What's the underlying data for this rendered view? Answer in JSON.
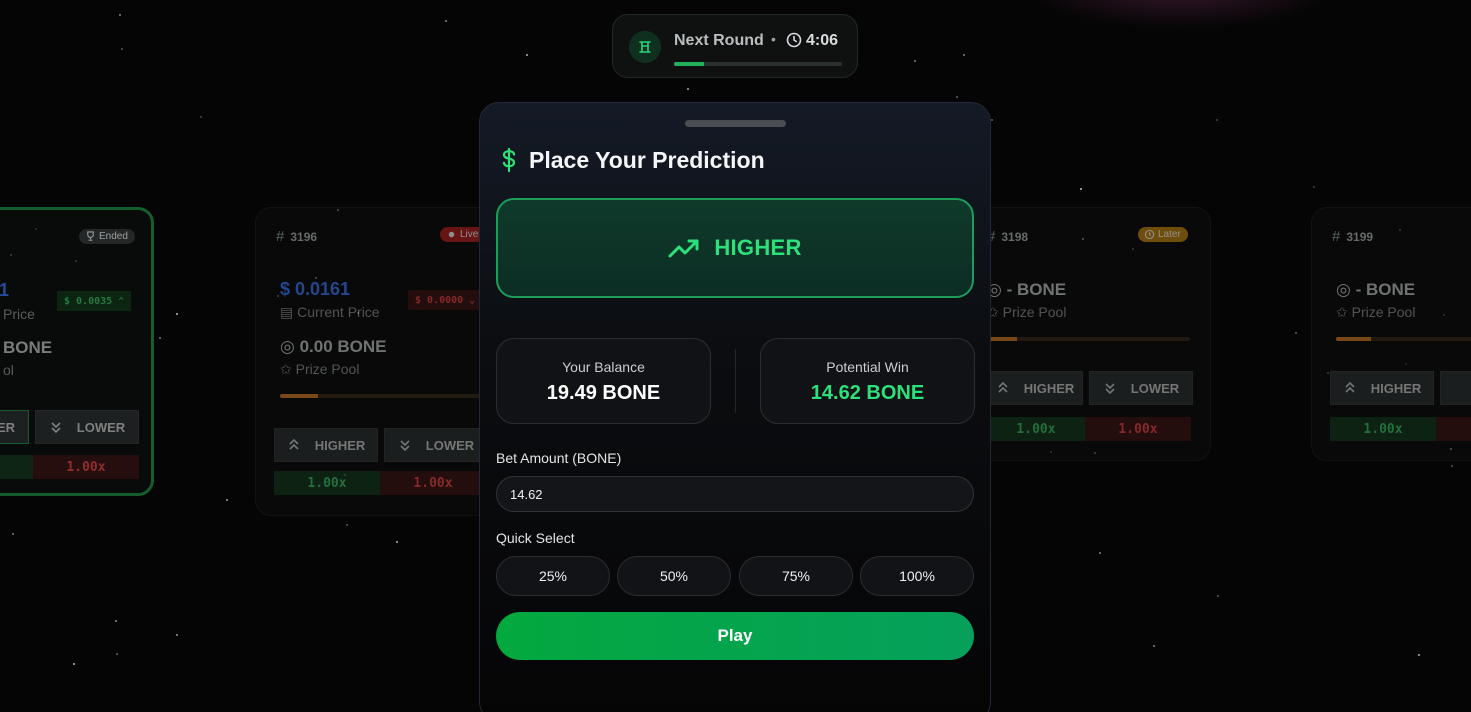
{
  "round": {
    "label": "Next Round",
    "separator": "•",
    "time": "4:06",
    "progress": 0.18
  },
  "cards": [
    {
      "id": "",
      "status": "Ended",
      "price": "",
      "price_label": "Price",
      "delta": "$ 0.0035 ⌃",
      "pool": "BONE",
      "pool_label": "ol",
      "pool_progress": 0,
      "higher_label": "ER",
      "lower_label": "LOWER",
      "higher_mult": "",
      "lower_mult": "1.00x"
    },
    {
      "id": "3196",
      "status": "Live",
      "price": "0.0161",
      "price_label": "Current Price",
      "delta": "$ 0.0000 ⌄",
      "pool": "0.00 BONE",
      "pool_label": "Prize Pool",
      "pool_progress": 0.18,
      "higher_label": "HIGHER",
      "lower_label": "LOWER",
      "higher_mult": "1.00x",
      "lower_mult": "1.00x"
    },
    {
      "id": "3198",
      "status": "Later",
      "pool": "- BONE",
      "pool_label": "Prize Pool",
      "pool_progress": 0.15,
      "higher_label": "HIGHER",
      "lower_label": "LOWER",
      "higher_mult": "1.00x",
      "lower_mult": "1.00x"
    },
    {
      "id": "3199",
      "status": "",
      "pool": "- BONE",
      "pool_label": "Prize Pool",
      "pool_progress": 0.2,
      "higher_label": "HIGHER",
      "lower_label": "",
      "higher_mult": "1.00x",
      "lower_mult": ""
    }
  ],
  "modal": {
    "title": "Place Your Prediction",
    "direction": "HIGHER",
    "balance_label": "Your Balance",
    "balance_value": "19.49 BONE",
    "win_label": "Potential Win",
    "win_value": "14.62 BONE",
    "bet_label": "Bet Amount (BONE)",
    "bet_value": "14.62",
    "quick_label": "Quick Select",
    "quick": [
      "25%",
      "50%",
      "75%",
      "100%"
    ],
    "play_label": "Play"
  },
  "colors": {
    "accent_green": "#2ee07a",
    "price_blue": "#3f7cff",
    "danger_red": "#f0484a",
    "pool_orange": "#d8822a",
    "play_green": "#03a83e"
  }
}
